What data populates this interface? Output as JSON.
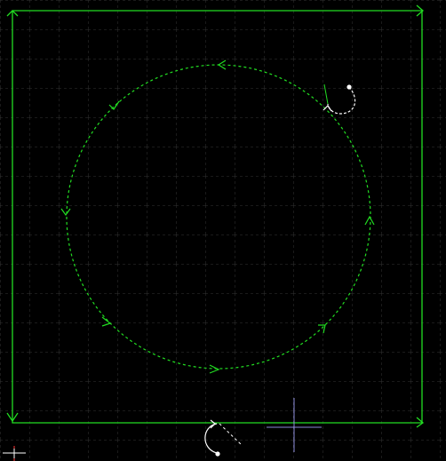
{
  "canvas": {
    "background_color": "#000000",
    "grid": {
      "visible": true,
      "style": "dashed",
      "color": "#3a3a3a"
    }
  },
  "toolpath": {
    "color": "#22dd22",
    "outer_contour": {
      "shape": "rectangle",
      "line_style": "solid",
      "direction": "clockwise"
    },
    "inner_contour": {
      "shape": "circle",
      "line_style": "dashed",
      "direction": "counter-clockwise"
    },
    "lead_ins": [
      {
        "name": "circle-lead-in",
        "line_style": "dashed",
        "color": "#ffffff"
      },
      {
        "name": "rectangle-lead-in",
        "line_style": "solid",
        "color": "#ffffff"
      }
    ]
  },
  "markers": {
    "origin": {
      "icon": "origin-crosshair-icon",
      "color": "#ff3333"
    },
    "cursor": {
      "icon": "crosshair-cursor-icon",
      "color": "#8a8ad8"
    }
  }
}
